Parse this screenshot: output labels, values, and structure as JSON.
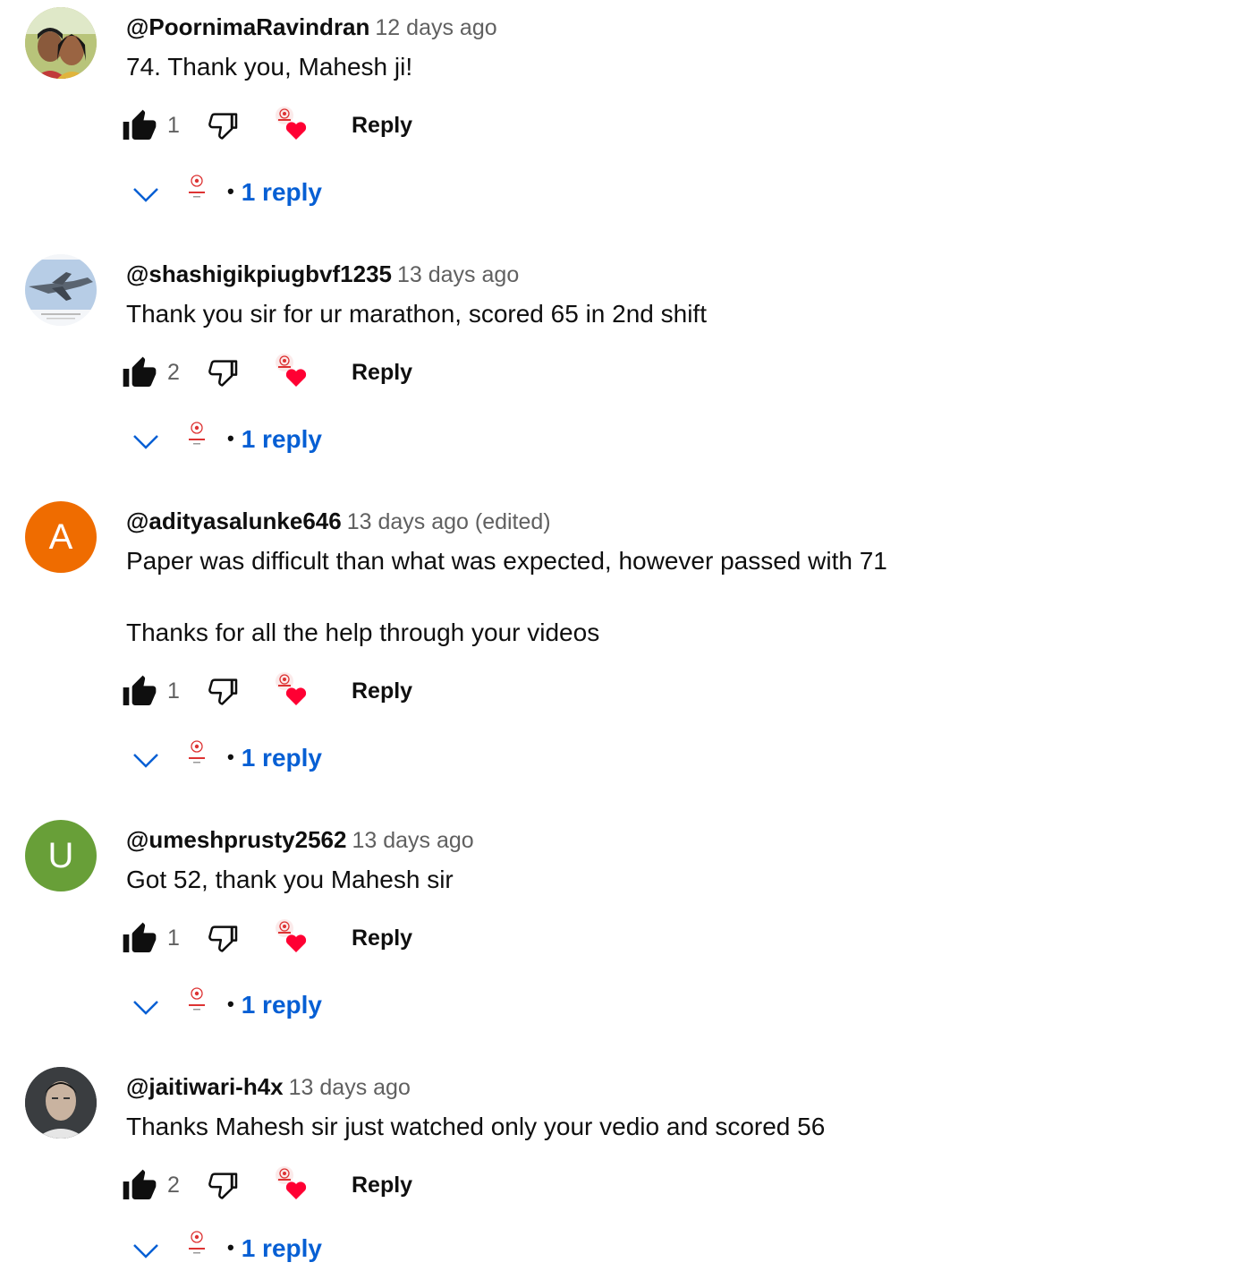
{
  "comments": [
    {
      "author": "@PoornimaRavindran",
      "time": "12 days ago",
      "text": [
        "74. Thank you, Mahesh ji!"
      ],
      "likes": "1",
      "reply_label": "Reply",
      "replies_label": "1 reply",
      "avatar_type": "photo-couple"
    },
    {
      "author": "@shashigikpiugbvf1235",
      "time": "13 days ago",
      "text": [
        "Thank you sir for ur marathon, scored 65 in 2nd shift"
      ],
      "likes": "2",
      "reply_label": "Reply",
      "replies_label": "1 reply",
      "avatar_type": "photo-jet"
    },
    {
      "author": "@adityasalunke646",
      "time": "13 days ago (edited)",
      "text": [
        "Paper was difficult than what was expected, however passed with 71",
        "Thanks for all the help through your videos"
      ],
      "likes": "1",
      "reply_label": "Reply",
      "replies_label": "1 reply",
      "avatar_type": "letter",
      "avatar_letter": "A",
      "avatar_color": "#ef6c00"
    },
    {
      "author": "@umeshprusty2562",
      "time": "13 days ago",
      "text": [
        "Got 52, thank you Mahesh sir"
      ],
      "likes": "1",
      "reply_label": "Reply",
      "replies_label": "1 reply",
      "avatar_type": "letter",
      "avatar_letter": "U",
      "avatar_color": "#689f38"
    },
    {
      "author": "@jaitiwari-h4x",
      "time": "13 days ago",
      "text": [
        "Thanks Mahesh sir just watched only your vedio and scored 56"
      ],
      "likes": "2",
      "reply_label": "Reply",
      "replies_label": "1 reply",
      "avatar_type": "photo-man"
    }
  ],
  "icons": {
    "like": "thumbs-up-icon",
    "dislike": "thumbs-down-icon",
    "creator_heart": "creator-heart-icon",
    "expand": "chevron-down-icon"
  },
  "colors": {
    "link": "#065fd4",
    "heart": "#ff0033",
    "secondary_text": "#606060"
  }
}
